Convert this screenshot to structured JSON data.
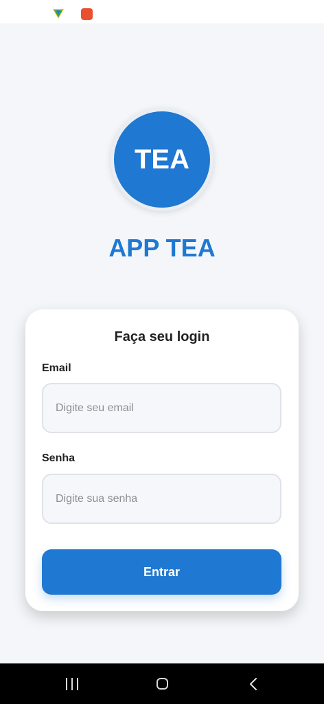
{
  "logo": {
    "text": "TEA"
  },
  "app": {
    "title": "APP TEA"
  },
  "login": {
    "heading": "Faça seu login",
    "email_label": "Email",
    "email_placeholder": "Digite seu email",
    "password_label": "Senha",
    "password_placeholder": "Digite sua senha",
    "submit_label": "Entrar"
  },
  "colors": {
    "primary": "#1f78d1",
    "background": "#f4f6f9",
    "card": "#ffffff"
  },
  "icons": {
    "status": [
      "vpn-shield-icon",
      "app-notification-icon"
    ],
    "navigation": [
      "recent-apps-icon",
      "home-icon",
      "back-icon"
    ]
  }
}
